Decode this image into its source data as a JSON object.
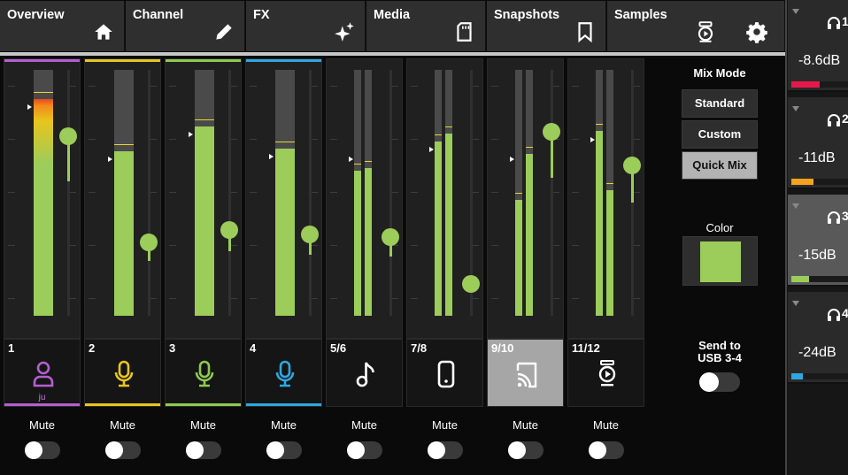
{
  "tabs": [
    {
      "label": "Overview",
      "icon": "home-icon"
    },
    {
      "label": "Channel",
      "icon": "pencil-icon"
    },
    {
      "label": "FX",
      "icon": "sparkle-icon"
    },
    {
      "label": "Media",
      "icon": "sd-card-icon"
    },
    {
      "label": "Snapshots",
      "icon": "bookmark-icon"
    },
    {
      "label": "Samples",
      "icon": "sampler-icon"
    }
  ],
  "settings_icon": "gear-icon",
  "channels": [
    {
      "number": "1",
      "icon": "person-icon",
      "sub_label": "ju",
      "color": "#b45fd1",
      "meter_left_level": 0.88,
      "meter_right_level": null,
      "fader_level": 0.73,
      "muted": false,
      "selected": false
    },
    {
      "number": "2",
      "icon": "microphone-icon",
      "sub_label": "",
      "color": "#e8c51c",
      "meter_left_level": 0.67,
      "meter_right_level": null,
      "fader_level": 0.3,
      "muted": false,
      "selected": false
    },
    {
      "number": "3",
      "icon": "microphone-icon",
      "sub_label": "",
      "color": "#8fc94e",
      "meter_left_level": 0.77,
      "meter_right_level": null,
      "fader_level": 0.35,
      "muted": false,
      "selected": false
    },
    {
      "number": "4",
      "icon": "microphone-icon",
      "sub_label": "",
      "color": "#2ea7e0",
      "meter_left_level": 0.68,
      "meter_right_level": null,
      "fader_level": 0.33,
      "muted": false,
      "selected": false
    },
    {
      "number": "5/6",
      "icon": "music-note-icon",
      "sub_label": "",
      "color": "",
      "meter_left_level": 0.59,
      "meter_right_level": 0.6,
      "fader_level": 0.32,
      "muted": false,
      "selected": false
    },
    {
      "number": "7/8",
      "icon": "phone-icon",
      "sub_label": "",
      "color": "",
      "meter_left_level": 0.71,
      "meter_right_level": 0.74,
      "fader_level": 0.13,
      "muted": false,
      "selected": false
    },
    {
      "number": "9/10",
      "icon": "cast-icon",
      "sub_label": "",
      "color": "",
      "meter_left_level": 0.47,
      "meter_right_level": 0.66,
      "fader_level": 0.75,
      "muted": false,
      "selected": true
    },
    {
      "number": "11/12",
      "icon": "sampler-icon",
      "sub_label": "",
      "color": "",
      "meter_left_level": 0.75,
      "meter_right_level": 0.51,
      "fader_level": 0.61,
      "muted": false,
      "selected": false
    }
  ],
  "mute_label": "Mute",
  "mix_mode": {
    "label": "Mix Mode",
    "options": [
      "Standard",
      "Custom",
      "Quick Mix"
    ],
    "selected": "Quick Mix"
  },
  "color": {
    "label": "Color",
    "value": "#9ccc5a"
  },
  "send_to_usb": {
    "label_line1": "Send to",
    "label_line2": "USB 3-4",
    "enabled": false
  },
  "headphones": [
    {
      "number": "1",
      "value": "-8.6dB",
      "bar_color": "#e8174a",
      "level": 0.45,
      "selected": false
    },
    {
      "number": "2",
      "value": "-11dB",
      "bar_color": "#f5a31c",
      "level": 0.36,
      "selected": false
    },
    {
      "number": "3",
      "value": "-15dB",
      "bar_color": "#9ccc5a",
      "level": 0.28,
      "selected": true
    },
    {
      "number": "4",
      "value": "-24dB",
      "bar_color": "#2ea7e0",
      "level": 0.18,
      "selected": false
    }
  ]
}
